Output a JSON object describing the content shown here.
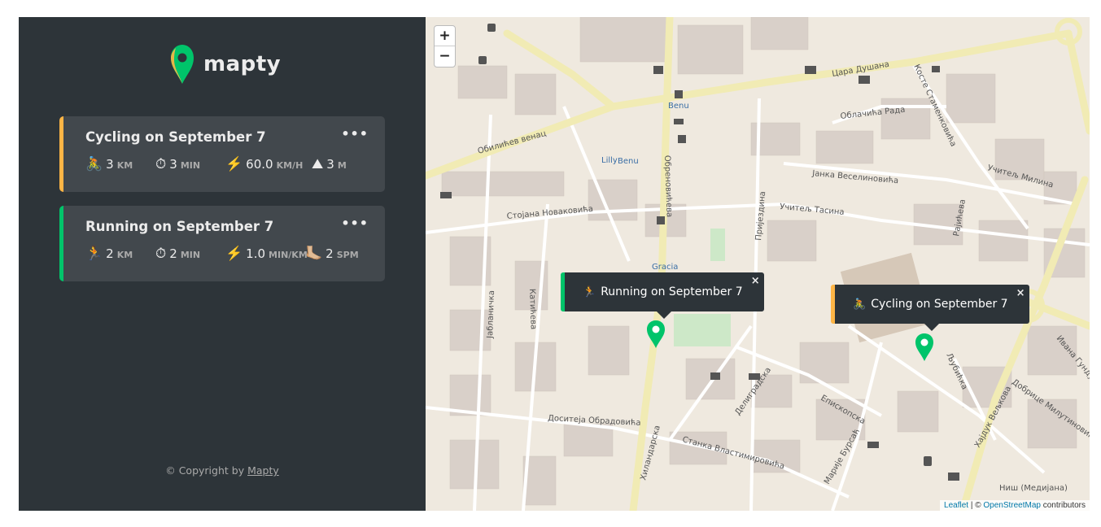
{
  "app": {
    "name": "mapty"
  },
  "workouts": [
    {
      "type": "cycling",
      "title": "Cycling on September 7",
      "menu": "•••",
      "details": [
        {
          "icon": "🚴",
          "value": "3",
          "unit": "km"
        },
        {
          "icon": "⏱",
          "value": "3",
          "unit": "min"
        },
        {
          "icon": "⚡️",
          "value": "60.0",
          "unit": "km/h"
        },
        {
          "icon": "⛰",
          "value": "3",
          "unit": "m"
        }
      ]
    },
    {
      "type": "running",
      "title": "Running on September 7",
      "menu": "•••",
      "details": [
        {
          "icon": "🏃",
          "value": "2",
          "unit": "km"
        },
        {
          "icon": "⏱",
          "value": "2",
          "unit": "min"
        },
        {
          "icon": "⚡️",
          "value": "1.0",
          "unit": "min/km"
        },
        {
          "icon": "🦶🏼",
          "value": "2",
          "unit": "spm"
        }
      ]
    }
  ],
  "footer": {
    "prefix": "© Copyright by ",
    "link": "Mapty"
  },
  "map": {
    "zoom_in": "+",
    "zoom_out": "−",
    "popups": [
      {
        "type": "running",
        "emoji": "🏃",
        "text": "Running on September 7",
        "close": "×"
      },
      {
        "type": "cycling",
        "emoji": "🚴",
        "text": "Cycling on September 7",
        "close": "×"
      }
    ],
    "attribution": {
      "leaflet": "Leaflet",
      "sep": " | © ",
      "osm": "OpenStreetMap",
      "suffix": " contributors"
    },
    "labels": {
      "cara_dusana": "Цара Душана",
      "obilicev_venac": "Обилићев венац",
      "oblacica_rada": "Облачића Рада",
      "janka_veselinovica": "Јанка Веселиновића",
      "ucitelj_tasina": "Учитељ Тасина",
      "ucitelj_milina": "Учитељ Милина",
      "stojana_novakovica": "Стојана Новаковића",
      "dositeja": "Доситеја Обрадовића",
      "stanka_vlastimirovica": "Станка Властимировића",
      "episkopska": "Епископска",
      "obrenoviceva": "Обреновићева",
      "prijezdina": "Пријездина",
      "rajiceva": "Рајићева",
      "jablanicka": "Јабланичка",
      "katiceva": "Катићева",
      "hilandarska": "Хиландарска",
      "delegradska": "Делиградска",
      "marije_bursac": "Марије Бурсаћ",
      "kosteStamenkovica": "Косте Стаменковића",
      "lubicka": "Љубићка",
      "hajduk_veljkova": "Хајдук Вељкова",
      "dobrice": "Добрице Милутиновића",
      "ivana_gundulica": "Ивана Гундулића",
      "nis_mediana": "Ниш (Медијана)",
      "benu1": "Benu",
      "benu2": "Benu",
      "lilly": "Lilly",
      "gracia": "Gracia"
    }
  }
}
